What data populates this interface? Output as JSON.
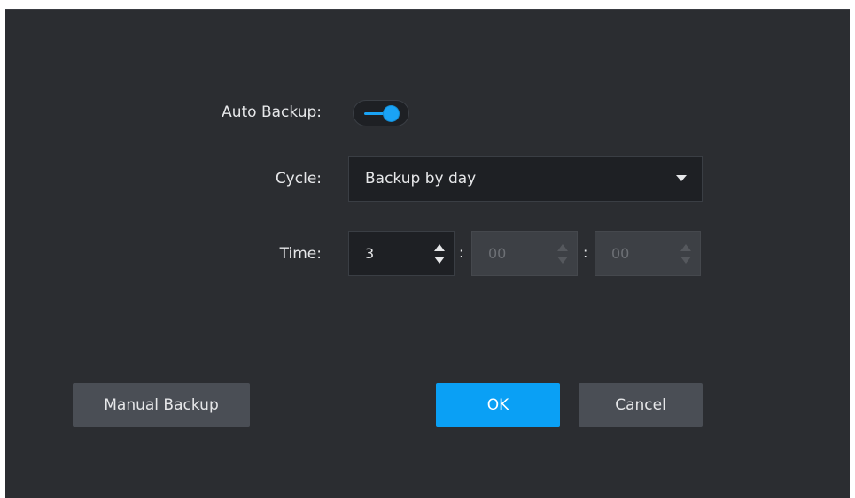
{
  "form": {
    "auto_backup_label": "Auto Backup:",
    "auto_backup_enabled": true,
    "cycle_label": "Cycle:",
    "cycle_value": "Backup by day",
    "time_label": "Time:",
    "time_hour": "3",
    "time_minute": "00",
    "time_second": "00",
    "separator": ":"
  },
  "buttons": {
    "manual_backup": "Manual Backup",
    "ok": "OK",
    "cancel": "Cancel"
  },
  "colors": {
    "accent": "#0aa0f5",
    "dialog_bg": "#2b2d31",
    "input_bg": "#1e2024",
    "disabled_bg": "#3d4045"
  }
}
